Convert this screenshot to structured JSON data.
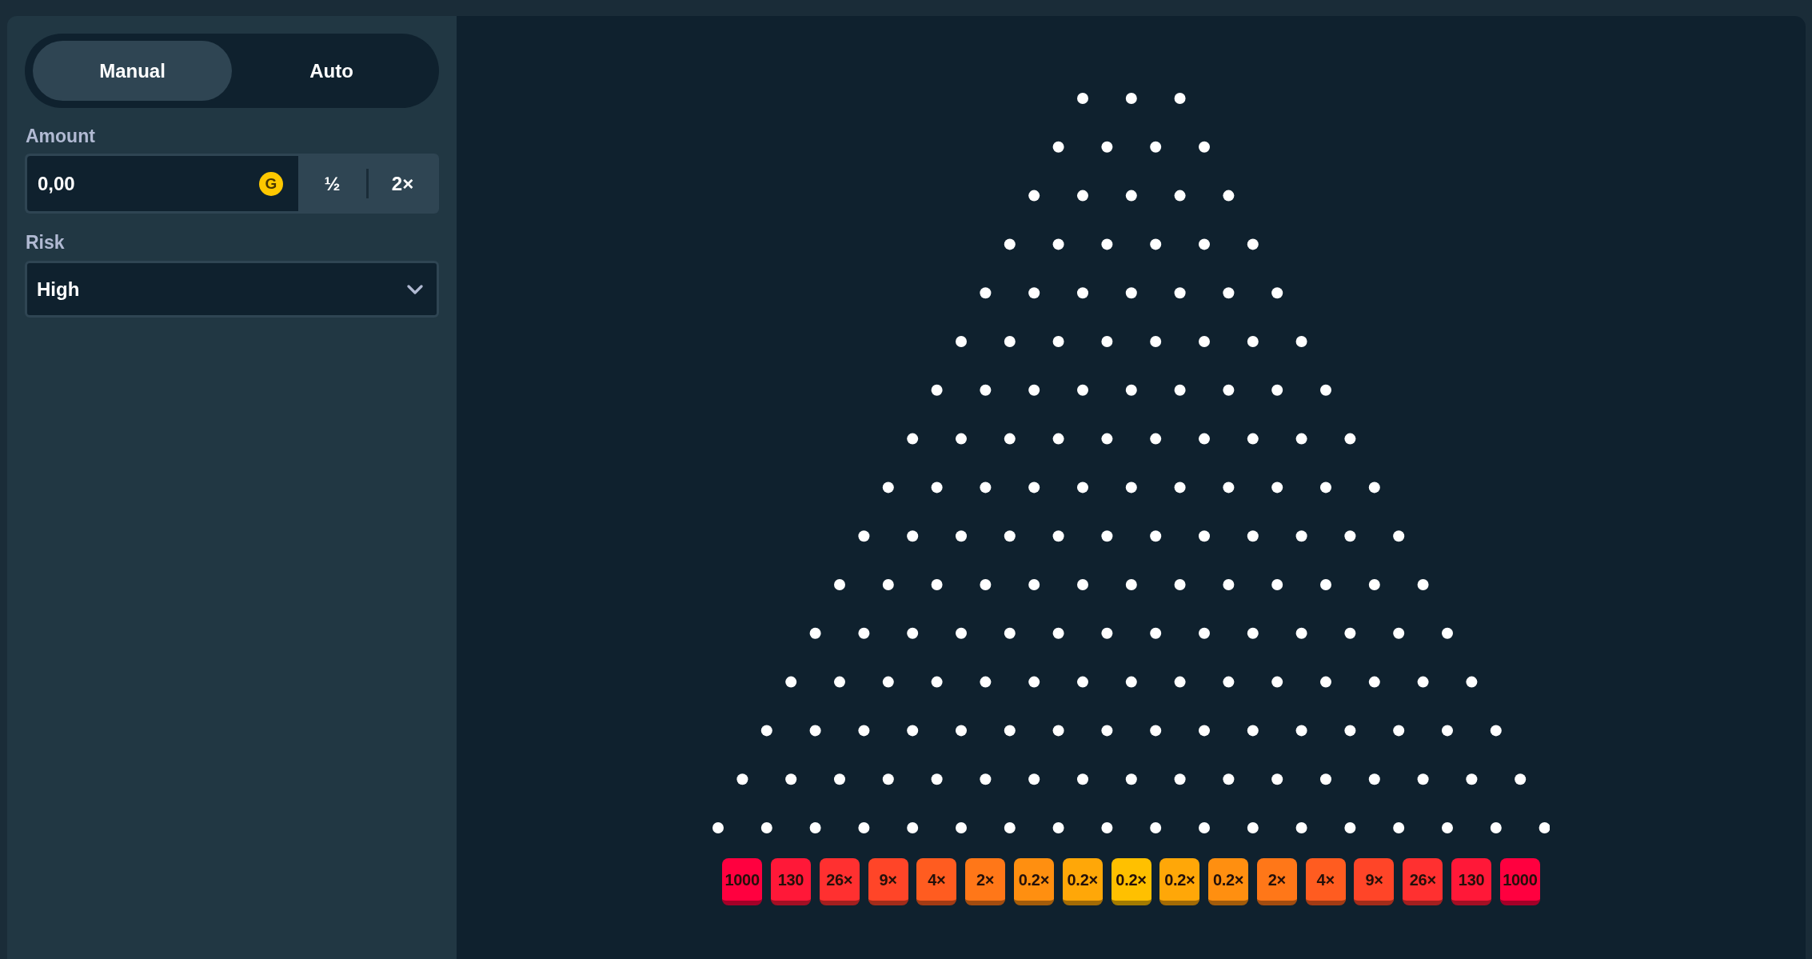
{
  "mode_tabs": [
    {
      "label": "Manual",
      "selected": true
    },
    {
      "label": "Auto",
      "selected": false
    }
  ],
  "amount": {
    "label": "Amount",
    "value": "0,00",
    "currency_symbol": "G",
    "buttons": [
      "½",
      "2×"
    ]
  },
  "risk": {
    "label": "Risk",
    "value": "High"
  },
  "board": {
    "multipliers": [
      {
        "label": "1000",
        "color": "#ff003f"
      },
      {
        "label": "130",
        "color": "#ff1838"
      },
      {
        "label": "26×",
        "color": "#ff3030"
      },
      {
        "label": "9×",
        "color": "#ff4528"
      },
      {
        "label": "4×",
        "color": "#ff5c20"
      },
      {
        "label": "2×",
        "color": "#ff7718"
      },
      {
        "label": "0.2×",
        "color": "#ff8f10"
      },
      {
        "label": "0.2×",
        "color": "#ffa708"
      },
      {
        "label": "0.2×",
        "color": "#ffc000"
      },
      {
        "label": "0.2×",
        "color": "#ffa708"
      },
      {
        "label": "0.2×",
        "color": "#ff8f10"
      },
      {
        "label": "2×",
        "color": "#ff7718"
      },
      {
        "label": "4×",
        "color": "#ff5c20"
      },
      {
        "label": "9×",
        "color": "#ff4528"
      },
      {
        "label": "26×",
        "color": "#ff3030"
      },
      {
        "label": "130",
        "color": "#ff1838"
      },
      {
        "label": "1000",
        "color": "#ff003f"
      }
    ]
  }
}
